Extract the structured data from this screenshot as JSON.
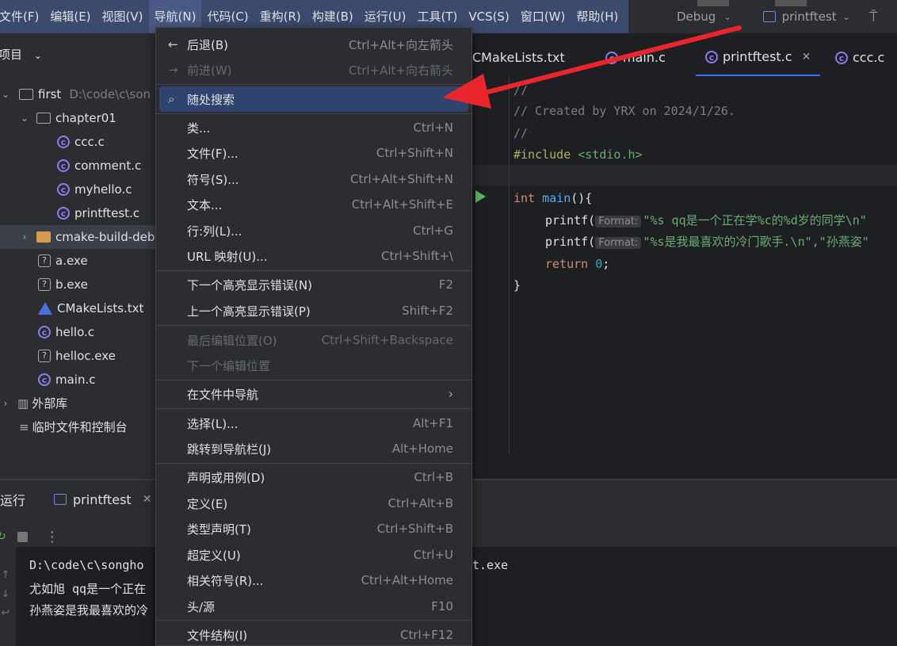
{
  "menubar": {
    "items": [
      "文件(F)",
      "编辑(E)",
      "视图(V)",
      "导航(N)",
      "代码(C)",
      "重构(R)",
      "构建(B)",
      "运行(U)",
      "工具(T)",
      "VCS(S)",
      "窗口(W)",
      "帮助(H)"
    ],
    "run_config": "Debug",
    "project_target": "printftest"
  },
  "project": {
    "header": "项目",
    "root_name": "first",
    "root_path": "D:\\code\\c\\son",
    "tree": [
      "chapter01",
      "ccc.c",
      "comment.c",
      "myhello.c",
      "printftest.c",
      "cmake-build-deb",
      "a.exe",
      "b.exe",
      "CMakeLists.txt",
      "hello.c",
      "helloc.exe",
      "main.c",
      "外部库",
      "临时文件和控制台"
    ]
  },
  "editor": {
    "tabs": [
      "CMakeLists.txt",
      "main.c",
      "printftest.c",
      "ccc.c"
    ],
    "code": {
      "l1": "//",
      "l2": "// Created by YRX on 2024/1/26.",
      "l3": "//",
      "include_kw": "#include",
      "include_hdr": "<stdio.h>",
      "main_type": "int",
      "main_name": "main",
      "main_rest": "(){",
      "printf": "printf(",
      "hint": "Format:",
      "str1": "\"%s qq是一个正在学%c的%d岁的同学\\n\"",
      "str2a": "\"%s是我最喜欢的冷门歌手.\\n\"",
      "str2b": ",\"孙燕姿\"",
      "ret_kw": "return",
      "ret_val": "0",
      "ret_end": ";",
      "close": "}"
    }
  },
  "run_panel": {
    "title": "运行",
    "tab": "printftest",
    "console": [
      "D:\\code\\c\\songho",
      "t.exe",
      "尤如旭 qq是一个正在",
      "孙燕姿是我最喜欢的冷"
    ]
  },
  "nav_menu": {
    "items": [
      {
        "label": "后退(B)",
        "shortcut": "Ctrl+Alt+向左箭头"
      },
      {
        "label": "前进(W)",
        "shortcut": "Ctrl+Alt+向右箭头"
      },
      {
        "label": "随处搜索",
        "shortcut": ""
      },
      {
        "label": "类...",
        "shortcut": "Ctrl+N"
      },
      {
        "label": "文件(F)...",
        "shortcut": "Ctrl+Shift+N"
      },
      {
        "label": "符号(S)...",
        "shortcut": "Ctrl+Alt+Shift+N"
      },
      {
        "label": "文本...",
        "shortcut": "Ctrl+Alt+Shift+E"
      },
      {
        "label": "行:列(L)...",
        "shortcut": "Ctrl+G"
      },
      {
        "label": "URL 映射(U)...",
        "shortcut": "Ctrl+Shift+\\"
      },
      {
        "label": "下一个高亮显示错误(N)",
        "shortcut": "F2"
      },
      {
        "label": "上一个高亮显示错误(P)",
        "shortcut": "Shift+F2"
      },
      {
        "label": "最后编辑位置(O)",
        "shortcut": "Ctrl+Shift+Backspace"
      },
      {
        "label": "下一个编辑位置",
        "shortcut": ""
      },
      {
        "label": "在文件中导航",
        "shortcut": ""
      },
      {
        "label": "选择(L)...",
        "shortcut": "Alt+F1"
      },
      {
        "label": "跳转到导航栏(J)",
        "shortcut": "Alt+Home"
      },
      {
        "label": "声明或用例(D)",
        "shortcut": "Ctrl+B"
      },
      {
        "label": "定义(E)",
        "shortcut": "Ctrl+Alt+B"
      },
      {
        "label": "类型声明(T)",
        "shortcut": "Ctrl+Shift+B"
      },
      {
        "label": "超定义(U)",
        "shortcut": "Ctrl+U"
      },
      {
        "label": "相关符号(R)...",
        "shortcut": "Ctrl+Alt+Home"
      },
      {
        "label": "头/源",
        "shortcut": "F10"
      },
      {
        "label": "文件结构(I)",
        "shortcut": "Ctrl+F12"
      }
    ]
  },
  "colors": {
    "highlight": "#2e436e",
    "accent": "#3574f0",
    "annotation": "#e8262b"
  }
}
